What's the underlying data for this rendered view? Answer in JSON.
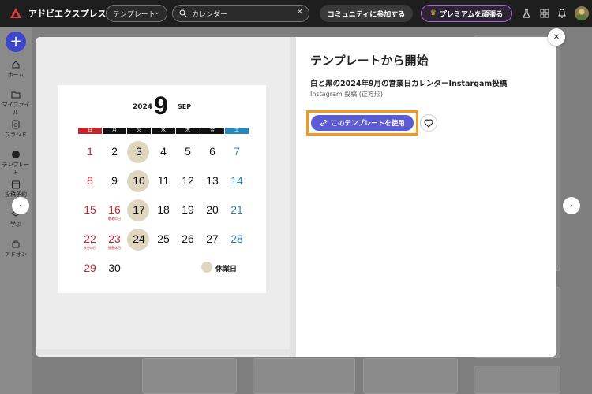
{
  "topbar": {
    "brand": "アドビエクスプレス",
    "template_dropdown": "テンプレート",
    "search_value": "カレンダー",
    "community_button": "コミュニティに参加する",
    "premium_button": "プレミアムを頑張る"
  },
  "sidebar": {
    "items": [
      {
        "label": "ホーム",
        "icon": "home-icon"
      },
      {
        "label": "マイファイル",
        "icon": "folder-icon"
      },
      {
        "label": "ブランド",
        "icon": "brand-icon"
      },
      {
        "label": "テンプレート",
        "icon": "template-icon"
      },
      {
        "label": "投稿予約",
        "icon": "calendar-icon"
      },
      {
        "label": "学ぶ",
        "icon": "learn-icon"
      },
      {
        "label": "アドオン",
        "icon": "addon-icon"
      }
    ]
  },
  "modal": {
    "title": "テンプレートから開始",
    "template_name": "白と黒の2024年9月の営業日カレンダーInstargam投稿",
    "template_type": "Instagram 投稿 (正方形)",
    "use_button": "このテンプレートを使用"
  },
  "calendar": {
    "year": "2024",
    "month": "9",
    "month_en": "SEP",
    "weekdays": [
      "日",
      "月",
      "火",
      "水",
      "木",
      "金",
      "土"
    ],
    "weeks": [
      [
        "1",
        "2",
        "3",
        "4",
        "5",
        "6",
        "7"
      ],
      [
        "8",
        "9",
        "10",
        "11",
        "12",
        "13",
        "14"
      ],
      [
        "15",
        "16",
        "17",
        "18",
        "19",
        "20",
        "21"
      ],
      [
        "22",
        "23",
        "24",
        "25",
        "26",
        "27",
        "28"
      ],
      [
        "29",
        "30"
      ]
    ],
    "notes": {
      "n16": "敬老の日",
      "n22": "秋分の日",
      "n23": "振替休日"
    },
    "legend": "休業日",
    "colors": {
      "red": "#c0272d",
      "blue": "#2b86b8",
      "highlight": "#ded6bf"
    }
  }
}
